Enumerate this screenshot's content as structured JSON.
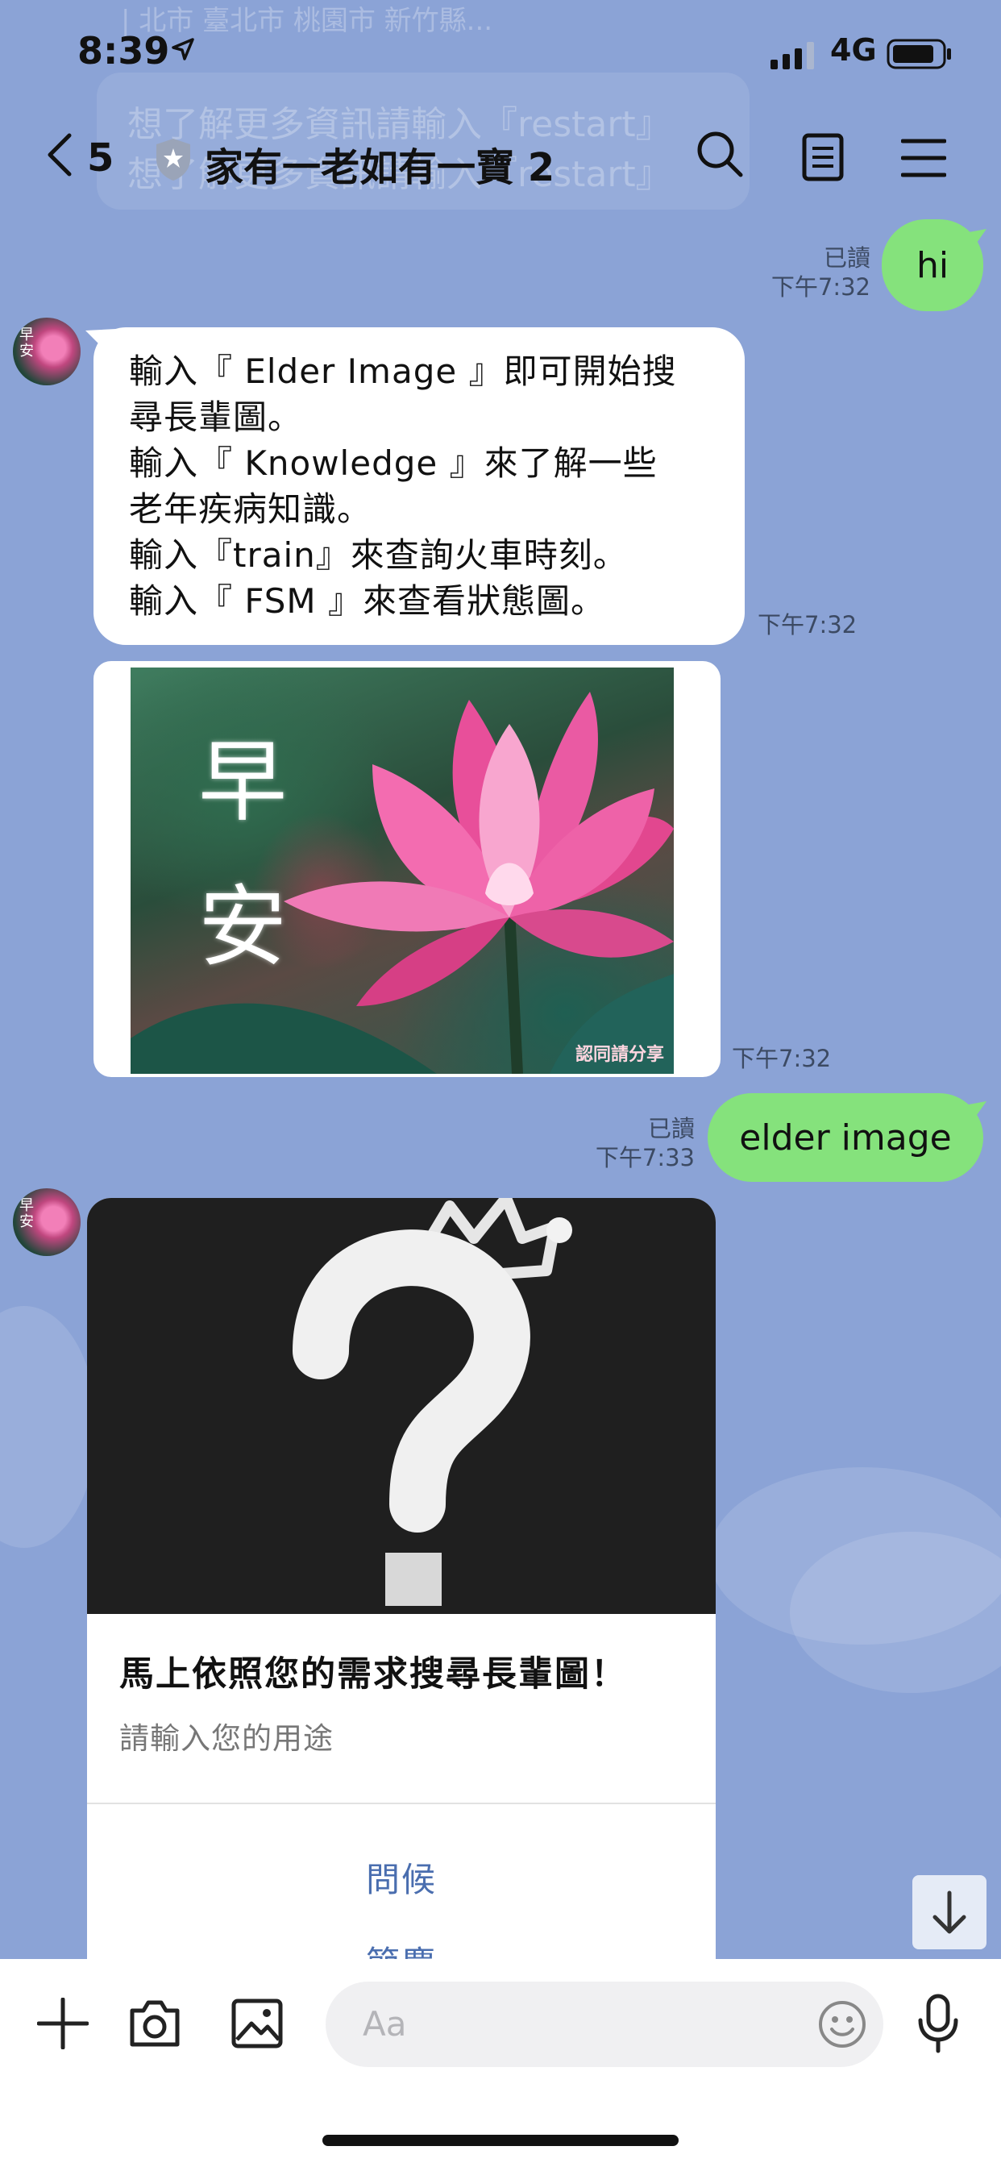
{
  "status": {
    "time": "8:39",
    "network": "4G"
  },
  "background": {
    "ghost_line1": "| 北市 臺北市 桃園市 新竹縣...",
    "ghost_line2": "想了解更多資訊請輸入『restart』",
    "ghost_line3": "想了解更多資訊請輸入『restart』"
  },
  "header": {
    "unread_count": "5",
    "title": "家有一老如有一寶 2"
  },
  "messages": {
    "m1": {
      "text": "hi",
      "read": "已讀",
      "time": "下午7:32"
    },
    "m2": {
      "lines": [
        "輸入『 Elder Image 』即可開始搜",
        "尋長輩圖。",
        "輸入『 Knowledge 』來了解一些",
        "老年疾病知識。",
        "輸入『train』來查詢火車時刻。",
        "輸入『 FSM 』來查看狀態圖。"
      ],
      "time": "下午7:32"
    },
    "m3": {
      "caption": "早安",
      "watermark": "認同請分享",
      "time": "下午7:32"
    },
    "m4": {
      "text": "elder image",
      "read": "已讀",
      "time": "下午7:33"
    },
    "card": {
      "title": "馬上依照您的需求搜尋長輩圖！",
      "subtitle": "請輸入您的用途",
      "options": [
        "問候",
        "節慶"
      ]
    }
  },
  "avatar_text": "早安",
  "input": {
    "placeholder": "Aa"
  },
  "colors": {
    "background": "#8ba3d6",
    "outgoing_bubble": "#85e27c",
    "link_option": "#4a6eaf"
  }
}
